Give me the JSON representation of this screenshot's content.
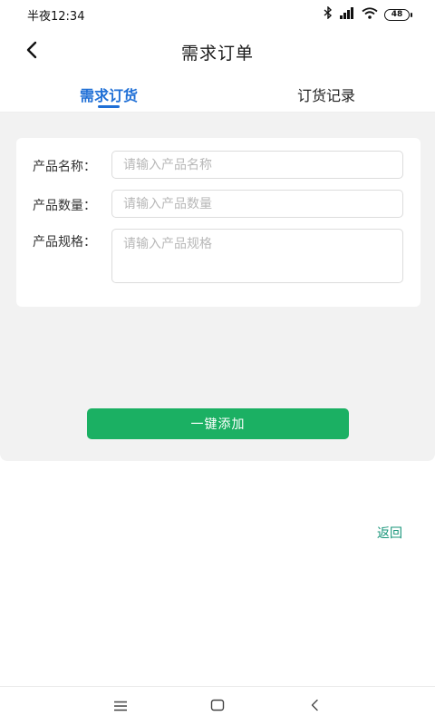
{
  "status_bar": {
    "time": "半夜12:34",
    "battery": "48",
    "icons": [
      "bluetooth-icon",
      "signal-icon",
      "wifi-icon",
      "battery-icon"
    ]
  },
  "header": {
    "title": "需求订单",
    "back_icon": "chevron-left-icon"
  },
  "tabs": [
    {
      "label": "需求订货",
      "active": true
    },
    {
      "label": "订货记录",
      "active": false
    }
  ],
  "form": {
    "fields": [
      {
        "label": "产品名称：",
        "placeholder": "请输入产品名称",
        "value": ""
      },
      {
        "label": "产品数量：",
        "placeholder": "请输入产品数量",
        "value": ""
      },
      {
        "label": "产品规格：",
        "placeholder": "请输入产品规格",
        "value": ""
      }
    ]
  },
  "actions": {
    "add_label": "一键添加",
    "return_label": "返回"
  },
  "colors": {
    "accent_blue": "#1f6fd6",
    "button_green": "#1bb063",
    "link_teal": "#18957a",
    "content_bg": "#f2f2f2"
  },
  "nav_bar": {
    "icons": [
      "menu-icon",
      "home-icon",
      "back-icon"
    ]
  }
}
